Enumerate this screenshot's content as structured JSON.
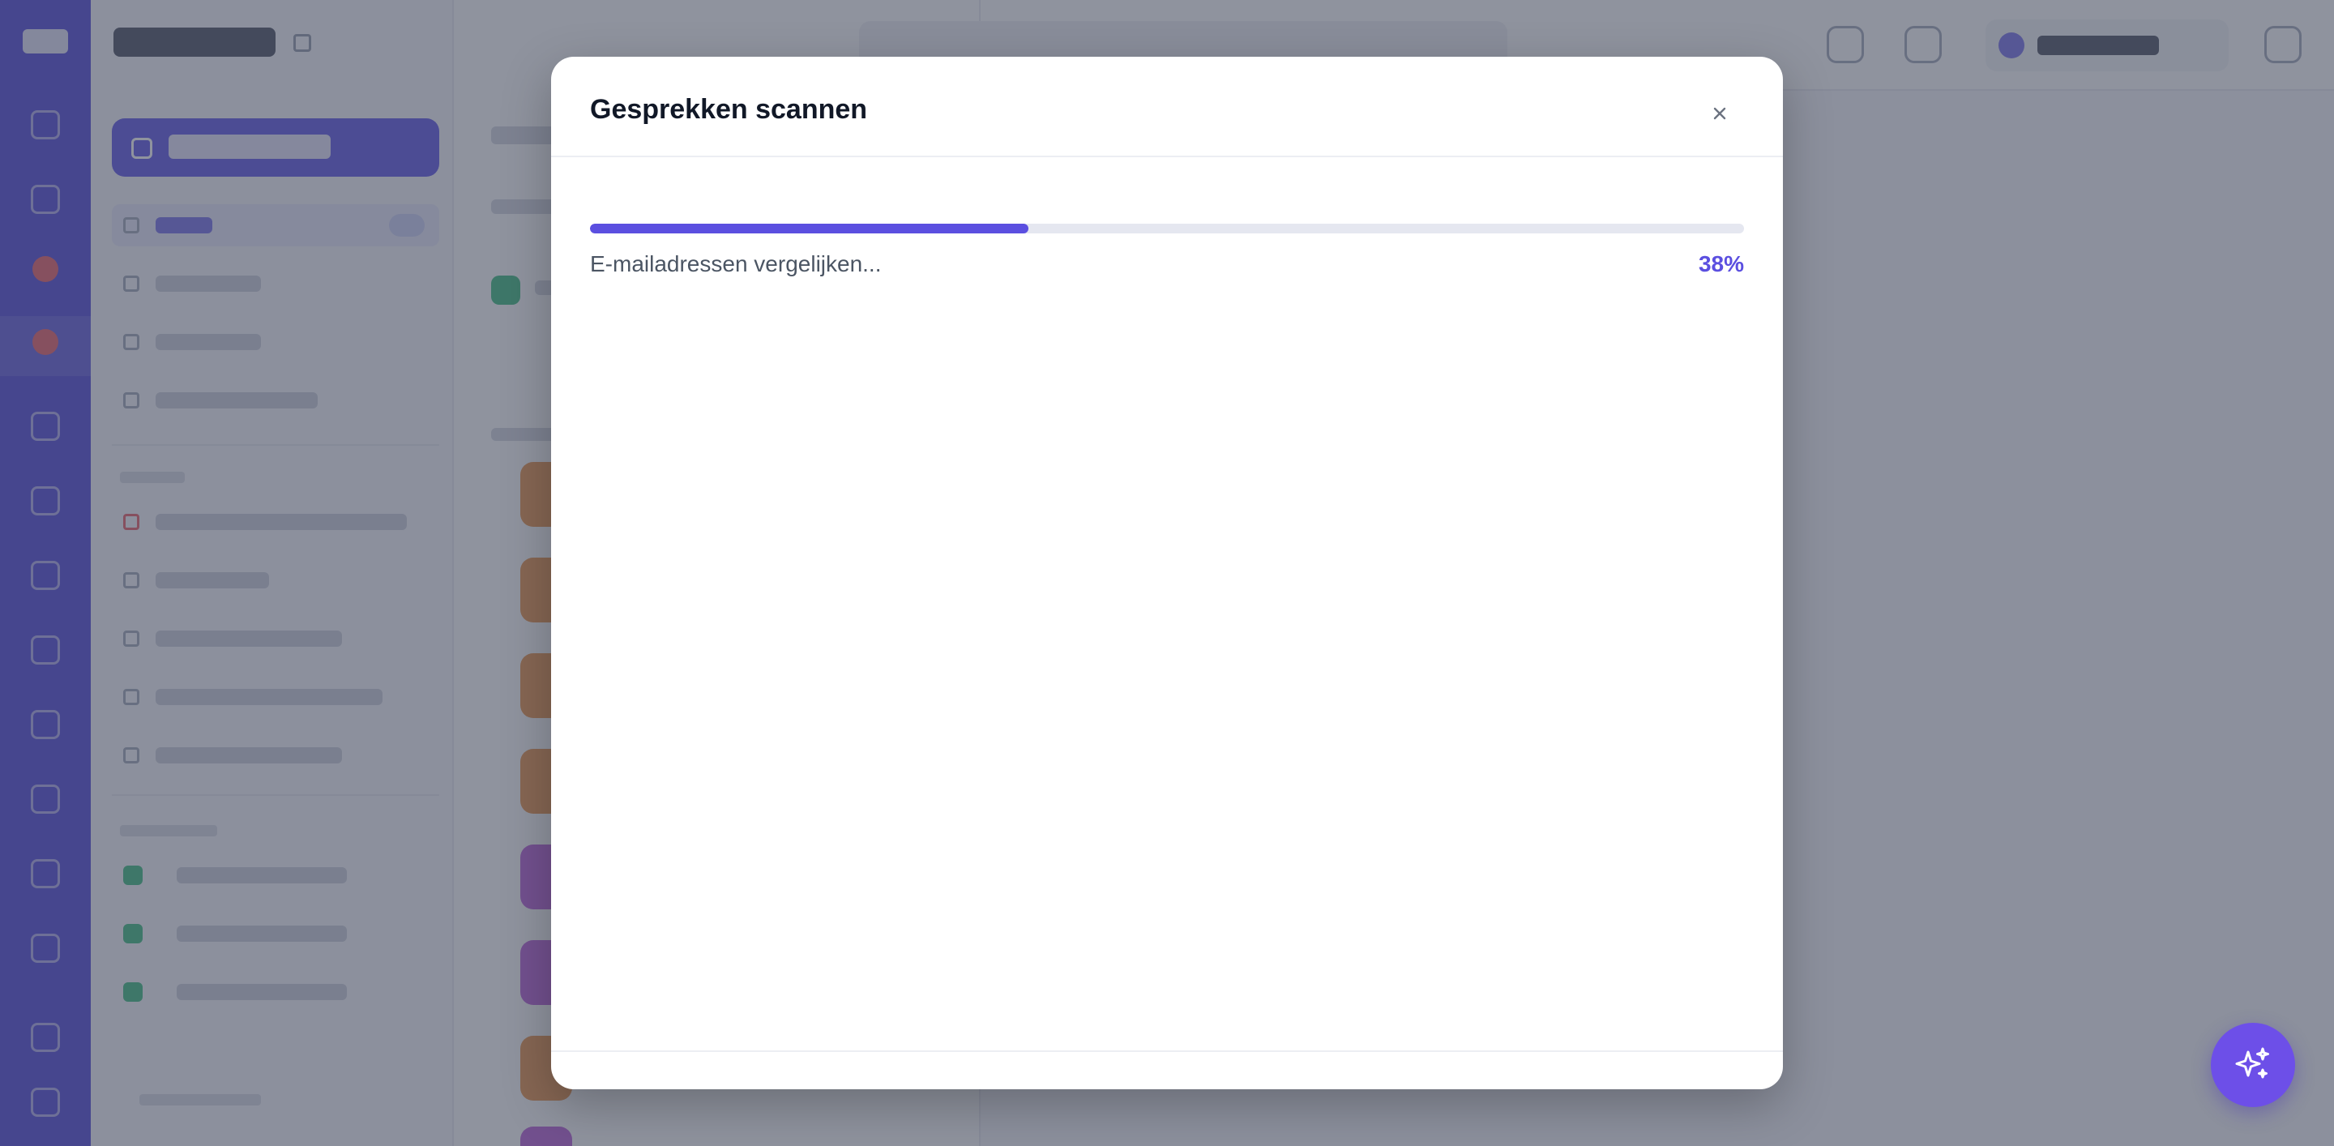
{
  "modal": {
    "title": "Gesprekken scannen",
    "close_icon": "close-icon",
    "progress": {
      "status_text": "E-mailadressen vergelijken...",
      "percent_label": "38%",
      "value": 0.38
    }
  },
  "assistant_button": {
    "icon": "sparkles-icon"
  },
  "colors": {
    "accent": "#5b4fe0",
    "fab": "#6d4fe8",
    "rail": "#3f35d4",
    "overlay": "rgba(74, 80, 99, 0.62)"
  }
}
